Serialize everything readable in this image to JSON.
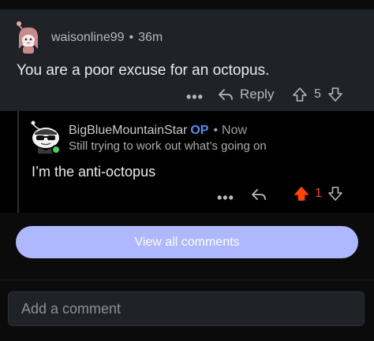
{
  "comment1": {
    "username": "waisonline99",
    "separator": "•",
    "age": "36m",
    "text": "You are a poor excuse for an octopus.",
    "more_label": "•••",
    "reply_label": "Reply",
    "vote_count": "5"
  },
  "comment2": {
    "username": "BigBlueMountainStar",
    "op_badge": "OP",
    "separator": "•",
    "age": "Now",
    "flair": "Still trying to work out what’s going on",
    "text": "I’m the anti-octopus",
    "more_label": "•••",
    "vote_count": "1",
    "upvoted": true,
    "upvote_color": "#ff4500"
  },
  "footer": {
    "view_all_label": "View all comments",
    "add_comment_placeholder": "Add a comment"
  },
  "colors": {
    "op": "#5a8dee",
    "button_bg": "#aeb8ff",
    "online_dot": "#46d160"
  },
  "icons": {
    "reply": "reply-arrow-icon",
    "upvote": "upvote-arrow-icon",
    "downvote": "downvote-arrow-icon",
    "more": "more-dots-icon"
  }
}
